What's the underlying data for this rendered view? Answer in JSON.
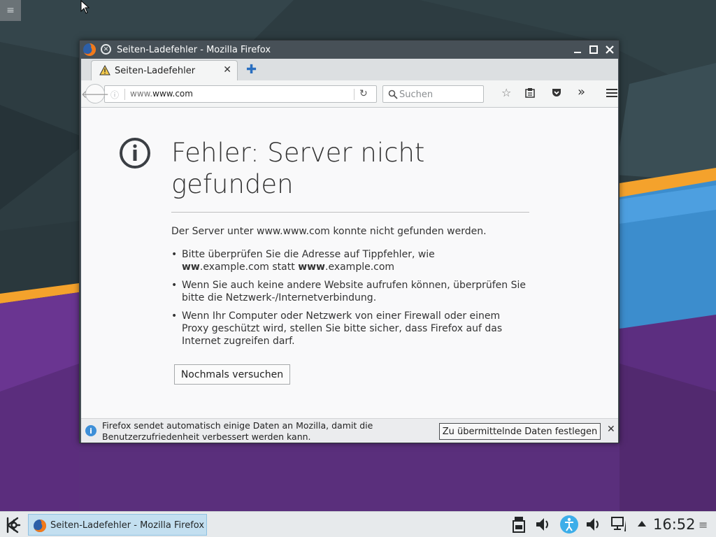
{
  "desktop": {
    "menu_icon": "hamburger-icon"
  },
  "window": {
    "title": "Seiten-Ladefehler - Mozilla Firefox",
    "tab": {
      "label": "Seiten-Ladefehler",
      "icon": "warning-icon"
    },
    "url": {
      "prefix": "www.",
      "host": "www.com"
    },
    "search_placeholder": "Suchen"
  },
  "error": {
    "title": "Fehler: Server nicht gefunden",
    "description": "Der Server unter www.www.com konnte nicht gefunden werden.",
    "tip1_text": "Bitte überprüfen Sie die Adresse auf Tippfehler, wie",
    "tip1_ex1_bold": "ww",
    "tip1_ex1_rest": ".example.com statt",
    "tip1_ex2_bold": "www",
    "tip1_ex2_rest": ".example.com",
    "tip2": "Wenn Sie auch keine andere Website aufrufen können, überprüfen Sie bitte die Netzwerk-/Internetverbindung.",
    "tip3": "Wenn Ihr Computer oder Netzwerk von einer Firewall oder einem Proxy geschützt wird, stellen Sie bitte sicher, dass Firefox auf das Internet zugreifen darf.",
    "retry_label": "Nochmals versuchen"
  },
  "notification": {
    "text": "Firefox sendet automatisch einige Daten an Mozilla, damit die Benutzerzufriedenheit verbessert werden kann.",
    "button_label": "Zu übermittelnde Daten festlegen"
  },
  "taskbar": {
    "task_label": "Seiten-Ladefehler - Mozilla Firefox",
    "clock": "16:52"
  },
  "colors": {
    "accent": "#3daee9",
    "task_active": "#c3dff0",
    "wallpaper_purple": "#5a2f7c",
    "wallpaper_orange": "#f5a623",
    "wallpaper_blue": "#3b8fd0"
  }
}
